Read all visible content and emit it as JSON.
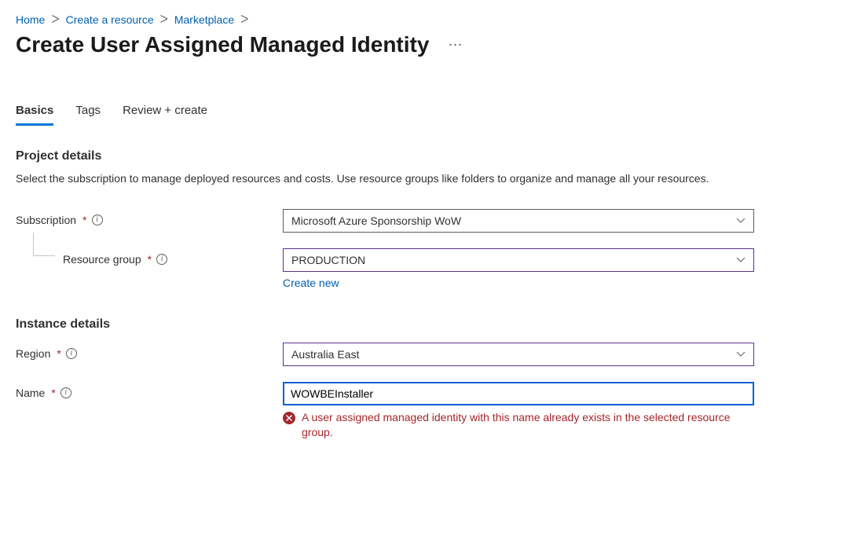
{
  "breadcrumb": [
    {
      "label": "Home"
    },
    {
      "label": "Create a resource"
    },
    {
      "label": "Marketplace"
    }
  ],
  "page": {
    "title": "Create User Assigned Managed Identity"
  },
  "tabs": {
    "basics": "Basics",
    "tags": "Tags",
    "review": "Review + create"
  },
  "sections": {
    "project": {
      "heading": "Project details",
      "desc": "Select the subscription to manage deployed resources and costs. Use resource groups like folders to organize and manage all your resources."
    },
    "instance": {
      "heading": "Instance details"
    }
  },
  "fields": {
    "subscription": {
      "label": "Subscription",
      "value": "Microsoft Azure Sponsorship WoW"
    },
    "resourceGroup": {
      "label": "Resource group",
      "value": "PRODUCTION",
      "createNew": "Create new"
    },
    "region": {
      "label": "Region",
      "value": "Australia East"
    },
    "name": {
      "label": "Name",
      "value": "WOWBEInstaller"
    }
  },
  "error": {
    "message": "A user assigned managed identity with this name already exists in the selected resource group."
  }
}
